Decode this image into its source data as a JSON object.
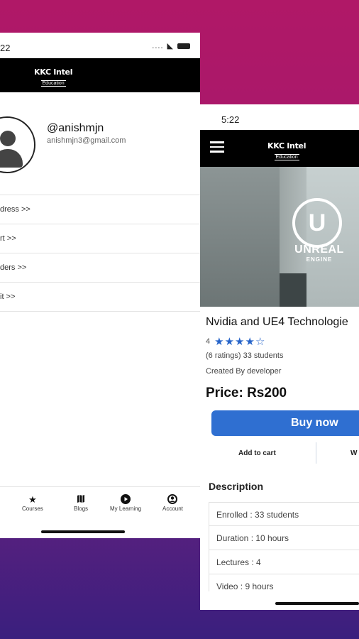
{
  "phone1": {
    "status_time": "22",
    "logo_line1": "KKC Intel",
    "logo_line2": "Education",
    "username": "@anishmjn",
    "email": "anishmjn3@gmail.com",
    "menu": [
      "dress >>",
      "rt >>",
      "ders >>",
      "it >>"
    ],
    "tabs": [
      {
        "label": "Courses",
        "icon": "star-icon"
      },
      {
        "label": "Blogs",
        "icon": "map-icon"
      },
      {
        "label": "My Learning",
        "icon": "play-icon"
      },
      {
        "label": "Account",
        "icon": "account-icon"
      }
    ]
  },
  "phone2": {
    "status_time": "5:22",
    "logo_line1": "KKC Intel",
    "logo_line2": "Education",
    "hero_brand": "UNREAL",
    "hero_sub": "ENGINE",
    "course_title": "Nvidia and UE4 Technologie",
    "rating_value": "4",
    "rating_stars": 4,
    "ratings_text": "(6 ratings) 33 students",
    "created_by": "Created By developer",
    "price": "Price: Rs200",
    "buy_label": "Buy now",
    "add_to_cart": "Add to cart",
    "wishlist": "W",
    "description_title": "Description",
    "info": [
      "Enrolled : 33 students",
      "Duration : 10 hours",
      "Lectures : 4",
      "Video : 9 hours"
    ]
  },
  "colors": {
    "accent": "#2f6fd1",
    "star": "#2563c9",
    "appbar": "#000000",
    "bg_top": "#b01867",
    "bg_bottom": "#3a1f7e"
  }
}
